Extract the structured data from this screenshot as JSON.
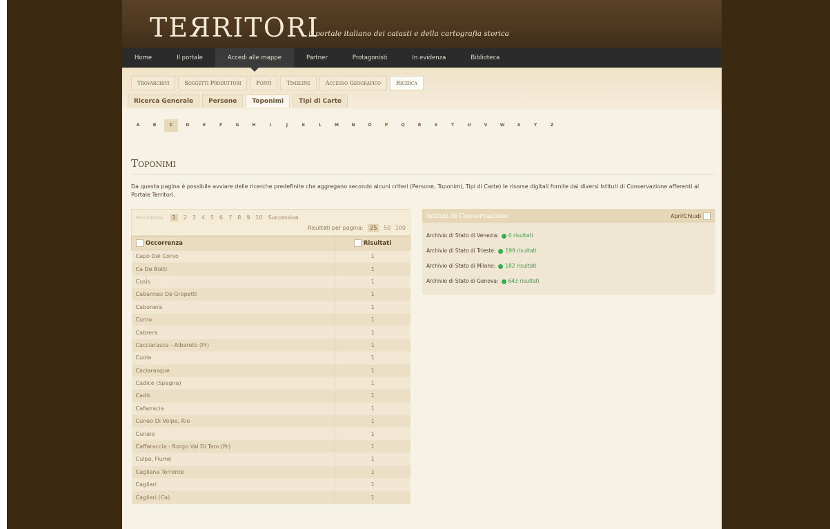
{
  "site": {
    "title": "TEЯRITORI",
    "tagline": "il portale italiano dei catasti e della cartografia storica"
  },
  "mainnav": [
    "Home",
    "Il portale",
    "Accedi alle mappe",
    "Partner",
    "Protagonisti",
    "In evidenza",
    "Biblioteca"
  ],
  "subnav": [
    "Trovarchivi",
    "Soggetti Produttori",
    "Fonti",
    "Timeline",
    "Accesso Geografico",
    "Ricerca"
  ],
  "filters": [
    "Ricerca Generale",
    "Persone",
    "Toponimi",
    "Tipi di Carte"
  ],
  "alphabet": [
    "A",
    "B",
    "C",
    "D",
    "E",
    "F",
    "G",
    "H",
    "I",
    "J",
    "K",
    "L",
    "M",
    "N",
    "O",
    "P",
    "Q",
    "R",
    "S",
    "T",
    "U",
    "V",
    "W",
    "X",
    "Y",
    "Z"
  ],
  "page": {
    "title": "Toponimi",
    "intro": "Da questa pagina è possibile avviare delle ricerche predefinite che aggregano secondo alcuni criteri (Persone, Toponimi, Tipi di Carte) le risorse digitali fornite dai diversi Istituti di Conservazione afferenti al Portale Territori."
  },
  "pager": {
    "prev": "Precedente",
    "pages": [
      "1",
      "2",
      "3",
      "4",
      "5",
      "6",
      "7",
      "8",
      "9",
      "10"
    ],
    "next": "Successiva",
    "per_page_label": "Risultati per pagina:",
    "per_page": [
      "25",
      "50",
      "100"
    ]
  },
  "table": {
    "col_occ": "Occorrenza",
    "col_res": "Risultati",
    "rows": [
      {
        "name": "Capo Del Corvo",
        "count": "1"
      },
      {
        "name": "Ca De Botti",
        "count": "1"
      },
      {
        "name": "Cusis",
        "count": "1"
      },
      {
        "name": "Cabannes De Gropetti",
        "count": "1"
      },
      {
        "name": "Cabonera",
        "count": "1"
      },
      {
        "name": "Curno",
        "count": "1"
      },
      {
        "name": "Cabrera",
        "count": "1"
      },
      {
        "name": "Cacciarasca - Albareto (Pr)",
        "count": "1"
      },
      {
        "name": "Cuola",
        "count": "1"
      },
      {
        "name": "Caciarasque",
        "count": "1"
      },
      {
        "name": "Cadice (Spagna)",
        "count": "1"
      },
      {
        "name": "Cadis",
        "count": "1"
      },
      {
        "name": "Cafarracia",
        "count": "1"
      },
      {
        "name": "Cuneo Di Volpe, Rio",
        "count": "1"
      },
      {
        "name": "Cuneio",
        "count": "1"
      },
      {
        "name": "Caffaraccia - Borgo Val Di Taro (Pr)",
        "count": "1"
      },
      {
        "name": "Culpa, Fiume",
        "count": "1"
      },
      {
        "name": "Cagliana Torrente",
        "count": "1"
      },
      {
        "name": "Cagliari",
        "count": "1"
      },
      {
        "name": "Cagliari (Ca)",
        "count": "1"
      }
    ]
  },
  "institutes": {
    "title": "Istituti di Conservazione",
    "toggle_label": "Apri/Chiudi",
    "items": [
      {
        "name": "Archivio di Stato di Venezia:",
        "count": "0 risultati"
      },
      {
        "name": "Archivio di Stato di Trieste:",
        "count": "199 risultati"
      },
      {
        "name": "Archivio di Stato di Milano:",
        "count": "182 risultati"
      },
      {
        "name": "Archivio di Stato di Genova:",
        "count": "643 risultati"
      }
    ]
  },
  "colors": {
    "accent": "#e6d7b7",
    "nav_bg": "#2b2b2b",
    "status_dot": "#2fb24a"
  }
}
